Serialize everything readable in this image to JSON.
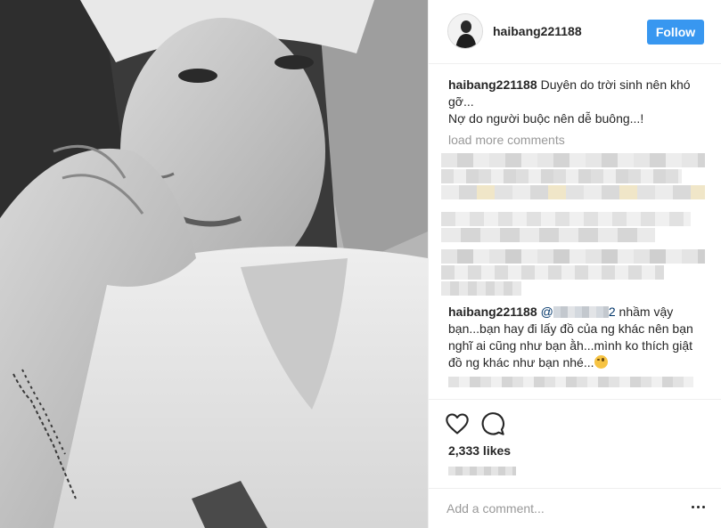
{
  "post": {
    "header": {
      "username": "haibang221188",
      "follow_label": "Follow"
    },
    "caption": {
      "username": "haibang221188",
      "line1": "Duyên do trời sinh nên khó gỡ...",
      "line2": "Nợ do người buộc nên dễ buông...!"
    },
    "load_more_label": "load more comments",
    "reply": {
      "username": "haibang221188",
      "mention_prefix": "@",
      "mention_suffix": "2",
      "text": " nhầm vậy bạn...bạn hay đi lấy đồ của ng khác nên bạn nghĩ ai cũng như bạn ằh...mình ko thích giật đồ ng khác như bạn nhé..."
    },
    "likes_label": "2,333 likes",
    "add_comment_placeholder": "Add a comment...",
    "icons": {
      "like": "heart-icon",
      "comment": "speech-bubble-icon",
      "more": "more-options-icon"
    },
    "colors": {
      "follow_button": "#3897f0",
      "muted_text": "#999999",
      "divider": "#efefef"
    }
  }
}
